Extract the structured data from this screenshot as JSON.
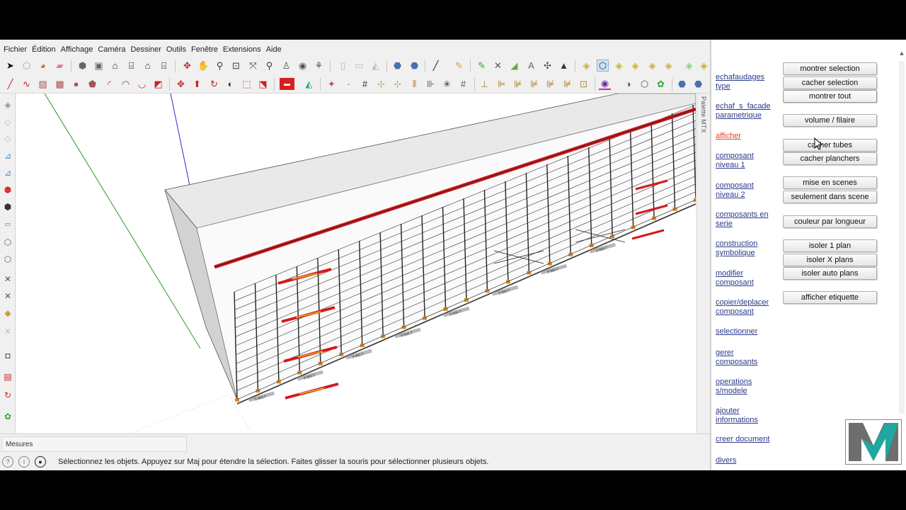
{
  "menu": [
    "Fichier",
    "Édition",
    "Affichage",
    "Caméra",
    "Dessiner",
    "Outils",
    "Fenêtre",
    "Extensions",
    "Aide"
  ],
  "palette_label": "Palette MTX",
  "measurements_label": "Mesures",
  "status_text": "Sélectionnez les objets. Appuyez sur Maj pour étendre la sélection. Faites glisser la souris pour sélectionner plusieurs objets.",
  "side_links": [
    {
      "label": "echafaudages type",
      "active": false
    },
    {
      "label": "echaf_s_facade parametrique",
      "active": false
    },
    {
      "label": "afficher",
      "active": true
    },
    {
      "label": "composant niveau 1",
      "active": false
    },
    {
      "label": "composant niveau 2",
      "active": false
    },
    {
      "label": "composants en serie",
      "active": false
    },
    {
      "label": "construction symbolique",
      "active": false
    },
    {
      "label": "modifier composant",
      "active": false
    },
    {
      "label": "copier/deplacer composant",
      "active": false
    },
    {
      "label": "selectionner",
      "active": false
    },
    {
      "label": "gerer composants",
      "active": false
    },
    {
      "label": "operations s/modele",
      "active": false
    },
    {
      "label": "ajouter informations",
      "active": false
    },
    {
      "label": "creer document",
      "active": false
    },
    {
      "label": "divers",
      "active": false
    }
  ],
  "buttons": [
    "montrer selection",
    "cacher selection",
    "montrer tout",
    "volume / filaire",
    "cacher tubes",
    "cacher planchers",
    "mise en scenes",
    "seulement dans scene",
    "couleur par longueur",
    "isoler 1 plan",
    "isoler X plans",
    "isoler auto plans",
    "afficher etiquette"
  ],
  "plank_label": "3 000.7",
  "colors": {
    "accent_red": "#d6181d",
    "plank_orange": "#d9892a",
    "link_blue": "#2a3a8c",
    "active_link": "#e0452a",
    "logo_teal": "#1fa7a0"
  }
}
